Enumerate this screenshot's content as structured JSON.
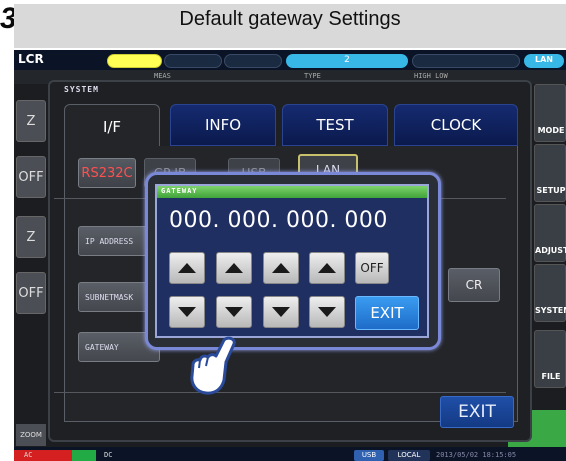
{
  "step_number": "3",
  "header": {
    "title": "Default gateway Settings"
  },
  "device": {
    "mode": "LCR",
    "top_pills": {
      "center": "2",
      "right": "LAN"
    },
    "bg_labels": [
      "MEAS",
      "TYPE",
      "HIGH LOW"
    ],
    "left_buttons": [
      "Z",
      "OFF",
      "Z",
      "OFF"
    ],
    "right_buttons": [
      "MODE",
      "SETUP",
      "ADJUST",
      "SYSTEM",
      "FILE"
    ],
    "zoom_label": "ZOOM",
    "green_block": "G",
    "bottom": {
      "left_ac": "AC",
      "left_dc": "DC",
      "usb": "USB",
      "local": "LOCAL",
      "datetime": "2013/05/02 18:15:05"
    }
  },
  "system": {
    "label": "SYSTEM",
    "tabs": [
      "I/F",
      "INFO",
      "TEST",
      "CLOCK"
    ],
    "interfaces": [
      "RS232C",
      "GP-IB",
      "USB",
      "LAN"
    ],
    "rows": [
      "IP ADDRESS",
      "SUBNETMASK",
      "GATEWAY"
    ],
    "cr_label": "CR",
    "exit_label": "EXIT"
  },
  "gateway_popup": {
    "title": "GATEWAY",
    "value": "000. 000. 000. 000",
    "off_label": "OFF",
    "exit_label": "EXIT"
  },
  "colors": {
    "screen_bg": "#1b1d20",
    "tab_inactive": "#0b1a4d",
    "popup_border": "#7a88d8",
    "title_green": "#3fa33a",
    "exit_blue": "#1e6cc8"
  }
}
